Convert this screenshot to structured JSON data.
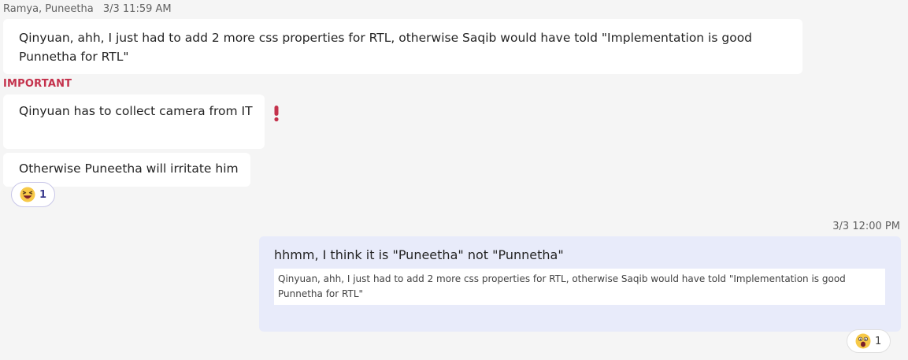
{
  "messages": {
    "incoming": {
      "sender": "Ramya, Puneetha",
      "timestamp": "3/3 11:59 AM",
      "msg1": "Qinyuan, ahh, I just had to add 2 more css properties for RTL, otherwise Saqib would have told \"Implementation is good Punnetha for RTL\"",
      "important_label": "IMPORTANT",
      "msg2": "Qinyuan has to collect camera from IT",
      "msg3": "Otherwise Puneetha will irritate him",
      "reaction": {
        "emoji": "laughing-icon",
        "count": "1",
        "color": "#f7c948"
      }
    },
    "outgoing": {
      "timestamp": "3/3 12:00 PM",
      "text": "hhmm, I think it is \"Puneetha\" not \"Punnetha\"",
      "quote": "Qinyuan, ahh, I just had to add 2 more css properties for RTL, otherwise Saqib would have told \"Implementation is good Punnetha for RTL\"",
      "reaction": {
        "emoji": "surprised-icon",
        "count": "1"
      }
    }
  },
  "colors": {
    "background": "#f5f5f5",
    "important": "#c4314b",
    "outgoing_bubble": "#e8ebfa",
    "reaction_border": "#c8c6e8"
  }
}
